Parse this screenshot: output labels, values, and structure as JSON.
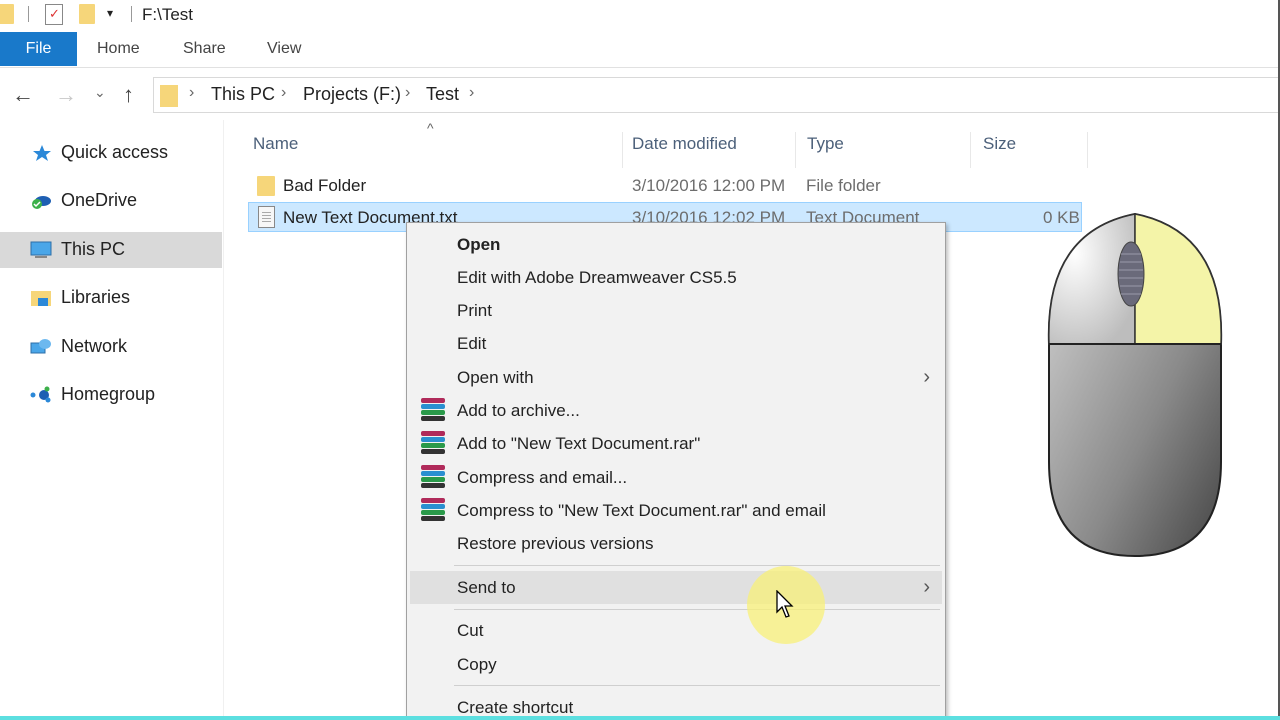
{
  "window": {
    "title": "F:\\Test"
  },
  "quick_access_toolbar": {
    "icons": [
      "folder-icon",
      "properties-icon",
      "new-folder-icon",
      "customize-dropdown-icon"
    ]
  },
  "ribbon": {
    "tabs": [
      {
        "label": "File",
        "active": true
      },
      {
        "label": "Home"
      },
      {
        "label": "Share"
      },
      {
        "label": "View"
      }
    ]
  },
  "navigation": {
    "back_icon": "←",
    "forward_icon": "→",
    "recent_icon": "⌄",
    "up_icon": "↑",
    "breadcrumb": [
      "This PC",
      "Projects (F:)",
      "Test"
    ],
    "separator": "›"
  },
  "sidebar": {
    "items": [
      {
        "label": "Quick access",
        "icon": "star-icon"
      },
      {
        "label": "OneDrive",
        "icon": "onedrive-icon"
      },
      {
        "label": "This PC",
        "icon": "computer-icon",
        "selected": true
      },
      {
        "label": "Libraries",
        "icon": "libraries-icon"
      },
      {
        "label": "Network",
        "icon": "network-icon"
      },
      {
        "label": "Homegroup",
        "icon": "homegroup-icon"
      }
    ]
  },
  "file_list": {
    "sort_indicator": "^",
    "columns": [
      "Name",
      "Date modified",
      "Type",
      "Size"
    ],
    "rows": [
      {
        "name": "Bad Folder",
        "date": "3/10/2016 12:00 PM",
        "type": "File folder",
        "size": "",
        "icon": "folder-icon"
      },
      {
        "name": "New Text Document.txt",
        "date": "3/10/2016 12:02 PM",
        "type": "Text Document",
        "size": "0 KB",
        "icon": "text-file-icon",
        "selected": true
      }
    ]
  },
  "context_menu": {
    "items": [
      {
        "label": "Open",
        "bold": true
      },
      {
        "label": "Edit with Adobe Dreamweaver CS5.5"
      },
      {
        "label": "Print"
      },
      {
        "label": "Edit"
      },
      {
        "label": "Open with",
        "submenu": true
      },
      {
        "label": "Add to archive...",
        "icon": "winrar-icon"
      },
      {
        "label": "Add to \"New Text Document.rar\"",
        "icon": "winrar-icon"
      },
      {
        "label": "Compress and email...",
        "icon": "winrar-icon"
      },
      {
        "label": "Compress to \"New Text Document.rar\" and email",
        "icon": "winrar-icon"
      },
      {
        "label": "Restore previous versions"
      },
      {
        "label": "Send to",
        "submenu": true,
        "hovered": true
      },
      {
        "label": "Cut"
      },
      {
        "label": "Copy"
      },
      {
        "label": "Create shortcut"
      }
    ],
    "submenu_arrow": "›"
  },
  "overlay": {
    "mouse_illustration": "right-button-highlighted",
    "highlight_color": "#f4f4a8",
    "cursor_highlight_color": "#f8f078"
  }
}
